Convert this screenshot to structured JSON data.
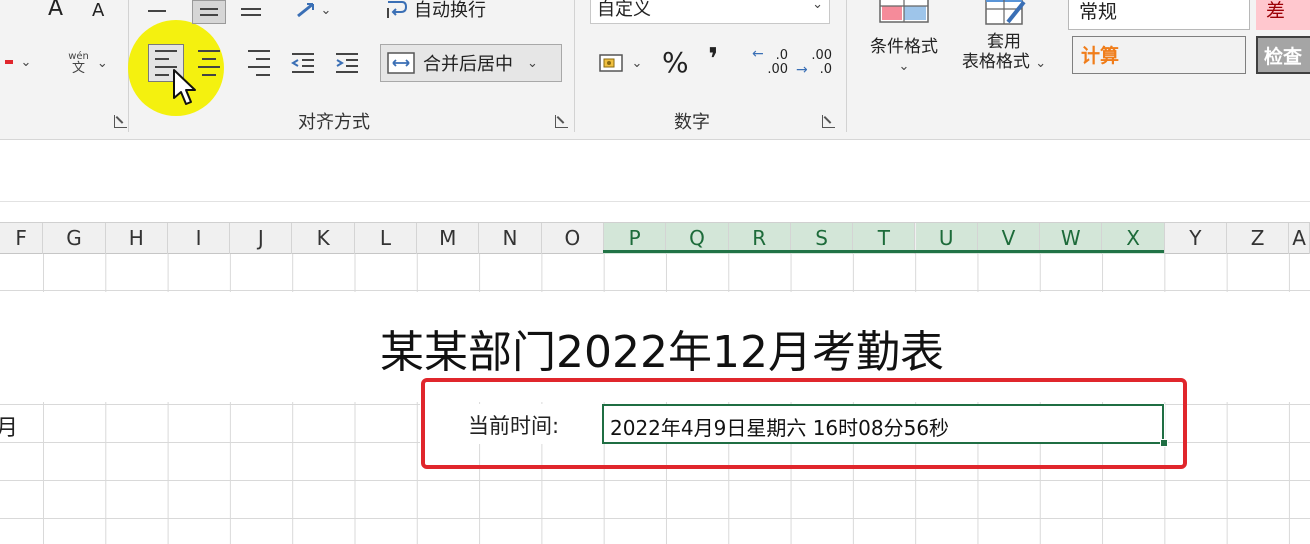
{
  "ribbon": {
    "font_group": {
      "font_grow": "A",
      "font_shrink": "A",
      "phonetic_top": "wén",
      "phonetic_bottom": "文"
    },
    "alignment_group": {
      "wrap_text": "自动换行",
      "merge_center": "合并后居中",
      "label": "对齐方式"
    },
    "number_group": {
      "format_value": "自定义",
      "percent": "%",
      "comma": "❜",
      "inc_decimal_top": ".0",
      "inc_decimal_bottom": ".00",
      "dec_decimal_top": ".00",
      "dec_decimal_bottom": ".0",
      "label": "数字"
    },
    "styles_group": {
      "conditional_format": "条件格式",
      "table_format_line1": "套用",
      "table_format_line2": "表格格式",
      "style_normal": "常规",
      "style_bad": "差",
      "style_calc": "计算",
      "style_check": "检查"
    },
    "colors": {
      "accent": "#217346",
      "highlight": "#f4f10f",
      "annotation": "#e0262c",
      "calc_text": "#f07d1a"
    }
  },
  "sheet": {
    "columns": [
      "F",
      "G",
      "H",
      "I",
      "J",
      "K",
      "L",
      "M",
      "N",
      "O",
      "P",
      "Q",
      "R",
      "S",
      "T",
      "U",
      "V",
      "W",
      "X",
      "Y",
      "Z",
      "A"
    ],
    "selected_columns": [
      "P",
      "Q",
      "R",
      "S",
      "T",
      "U",
      "V",
      "W",
      "X"
    ],
    "title": "某某部门2022年12月考勤表",
    "left_partial": "月",
    "time_label": "当前时间:",
    "time_value": "2022年4月9日星期六 16时08分56秒"
  }
}
